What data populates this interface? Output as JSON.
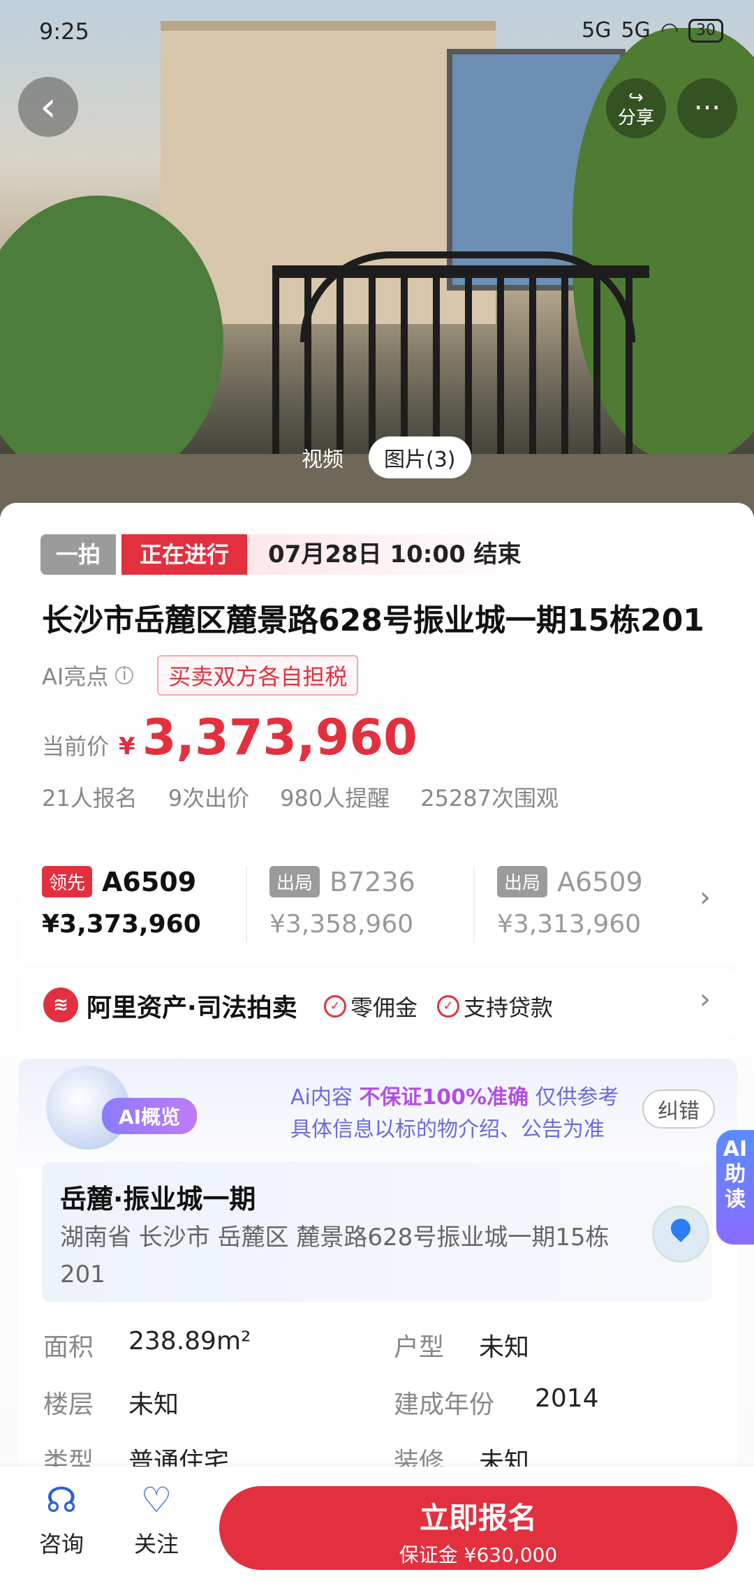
{
  "status_bar": {
    "time": "9:25",
    "signal1": "5G",
    "signal2": "5G",
    "battery": "30"
  },
  "hero": {
    "share_label": "分享",
    "tabs": [
      {
        "label": "视频",
        "active": false
      },
      {
        "label": "图片(3)",
        "active": true
      }
    ]
  },
  "auction": {
    "tag_round": "一拍",
    "tag_status": "正在进行",
    "end_time": "07月28日 10:00 结束",
    "title": "长沙市岳麓区麓景路628号振业城一期15栋201",
    "ai_label": "AI亮点",
    "tax_tag": "买卖双方各自担税",
    "price_label": "当前价",
    "price_yen": "¥",
    "price_value": "3,373,960",
    "stats": [
      "21人报名",
      "9次出价",
      "980人提醒",
      "25287次围观"
    ]
  },
  "bids": [
    {
      "status": "领先",
      "id": "A6509",
      "amount": "¥3,373,960",
      "leading": true
    },
    {
      "status": "出局",
      "id": "B7236",
      "amount": "¥3,358,960",
      "leading": false
    },
    {
      "status": "出局",
      "id": "A6509",
      "amount": "¥3,313,960",
      "leading": false
    }
  ],
  "platform": {
    "name": "阿里资产·司法拍卖",
    "features": [
      "零佣金",
      "支持贷款"
    ]
  },
  "ai_overview": {
    "badge": "AI概览",
    "disclaimer_prefix": "Ai内容",
    "disclaimer_highlight": "不保证100%准确",
    "disclaimer_suffix": "仅供参考",
    "disclaimer_line2": "具体信息以标的物介绍、公告为准",
    "report_button": "纠错",
    "community": "岳麓·振业城一期",
    "address": "湖南省 长沙市 岳麓区 麓景路628号振业城一期15栋201",
    "properties": [
      {
        "label": "面积",
        "value": "238.89m²"
      },
      {
        "label": "户型",
        "value": "未知"
      },
      {
        "label": "楼层",
        "value": "未知"
      },
      {
        "label": "建成年份",
        "value": "2014"
      },
      {
        "label": "类型",
        "value": "普通住宅"
      },
      {
        "label": "装修",
        "value": "未知"
      }
    ]
  },
  "ai_helper": {
    "line1": "AI",
    "line2": "助",
    "line3": "读"
  },
  "bottom_bar": {
    "consult_label": "咨询",
    "follow_label": "关注",
    "cta_label": "立即报名",
    "deposit_label": "保证金 ¥630,000"
  },
  "colors": {
    "accent": "#e2303f",
    "ai_purple": "#8a7bff"
  }
}
